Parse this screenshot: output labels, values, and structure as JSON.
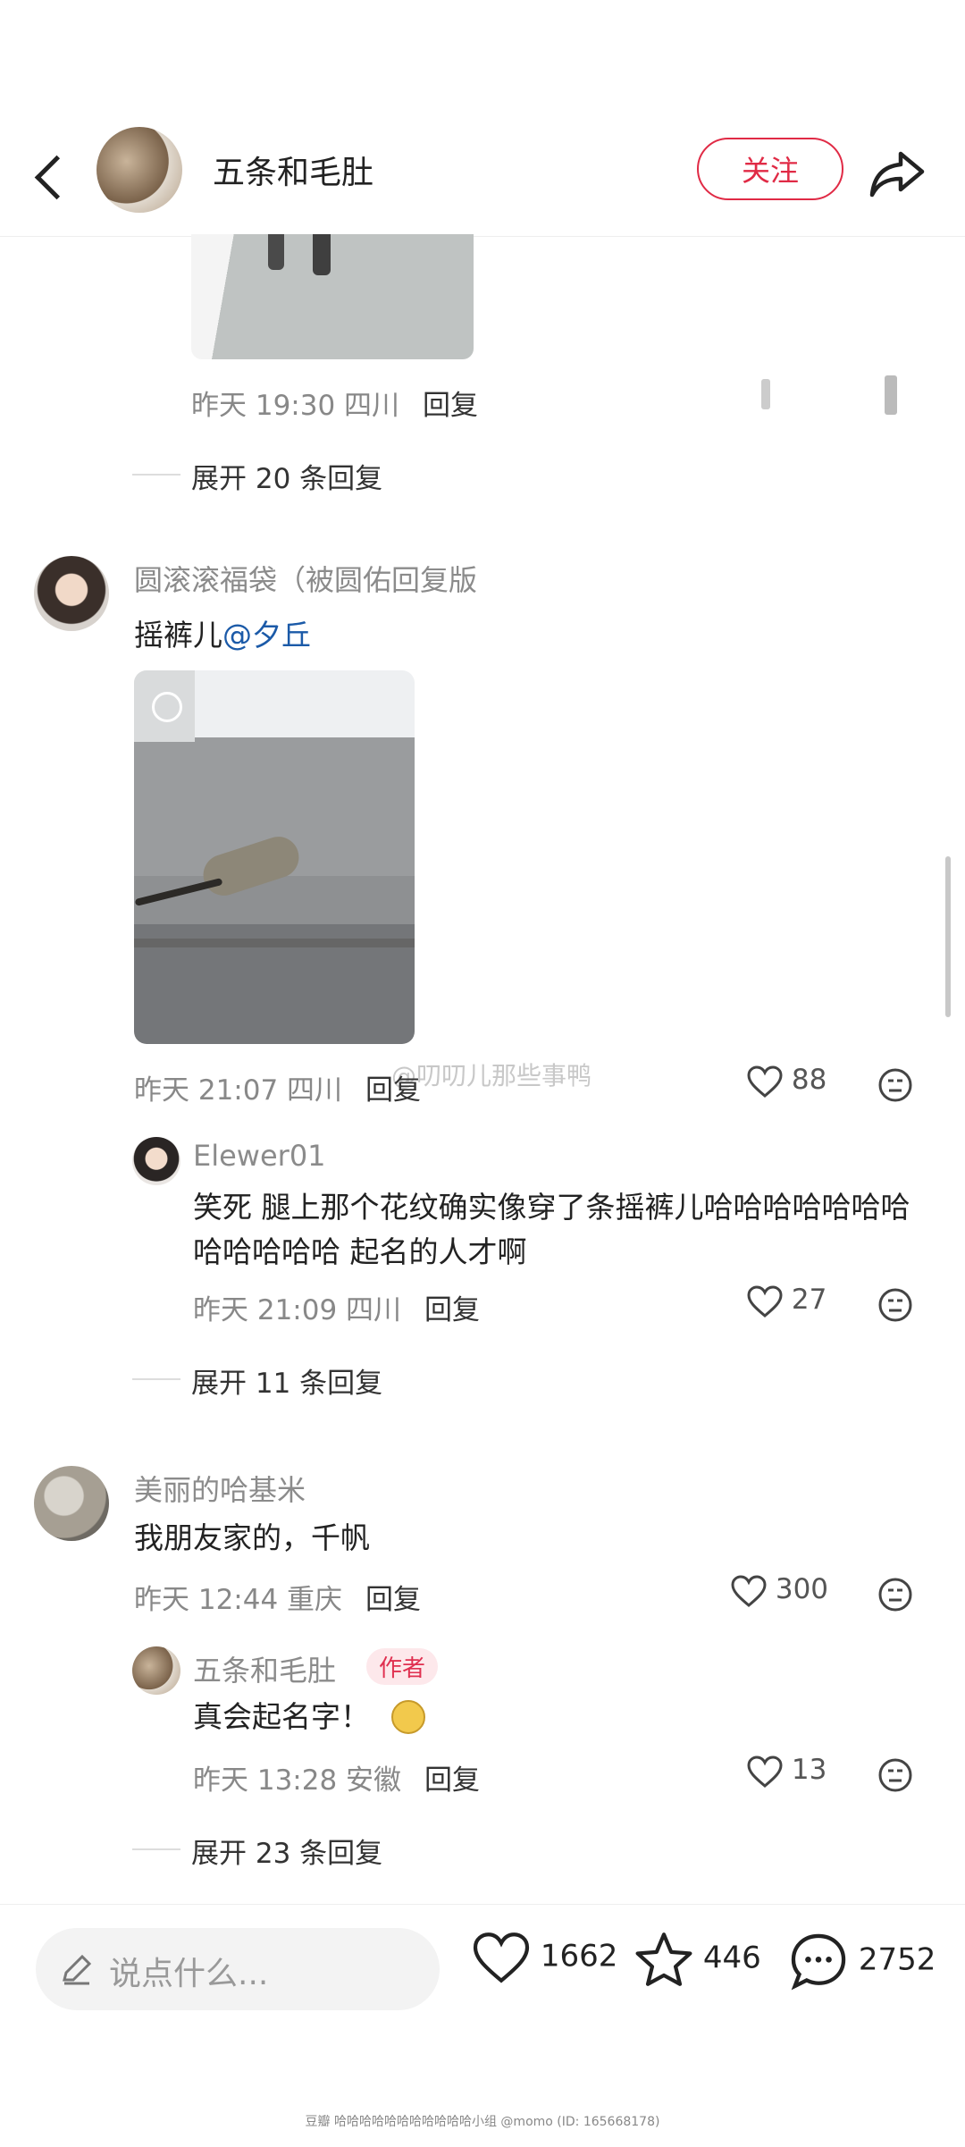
{
  "header": {
    "author_name": "五条和毛肚",
    "follow_label": "关注"
  },
  "comment_prev": {
    "meta": "昨天 19:30 四川",
    "reply_label": "回复",
    "expand": "展开 20 条回复"
  },
  "comment1": {
    "user": "圆滚滚福袋（被圆佑回复版",
    "text_prefix": "摇裤儿",
    "mention": "@夕丘",
    "meta": "昨天 21:07 四川",
    "reply_label": "回复",
    "likes": "88",
    "reply": {
      "user": "Elewer01",
      "text": "笑死 腿上那个花纹确实像穿了条摇裤儿哈哈哈哈哈哈哈哈哈哈哈哈 起名的人才啊",
      "meta": "昨天 21:09 四川",
      "reply_label": "回复",
      "likes": "27"
    },
    "expand": "展开 11 条回复"
  },
  "comment2": {
    "user": "美丽的哈基米",
    "text": "我朋友家的，千帆",
    "meta": "昨天 12:44 重庆",
    "reply_label": "回复",
    "likes": "300",
    "reply": {
      "user": "五条和毛肚",
      "tag": "作者",
      "text": "真会起名字！",
      "meta": "昨天 13:28 安徽",
      "reply_label": "回复",
      "likes": "13"
    },
    "expand": "展开 23 条回复"
  },
  "overlay_watermark": "@叨叨儿那些事鸭",
  "bottom": {
    "input_placeholder": "说点什么...",
    "likes": "1662",
    "stars": "446",
    "comments": "2752"
  },
  "footer_watermark": "豆瓣 哈哈哈哈哈哈哈哈哈哈哈小组 @momo (ID: 165668178)",
  "colors": {
    "accent": "#e02a45",
    "mention": "#1b5aa8"
  }
}
